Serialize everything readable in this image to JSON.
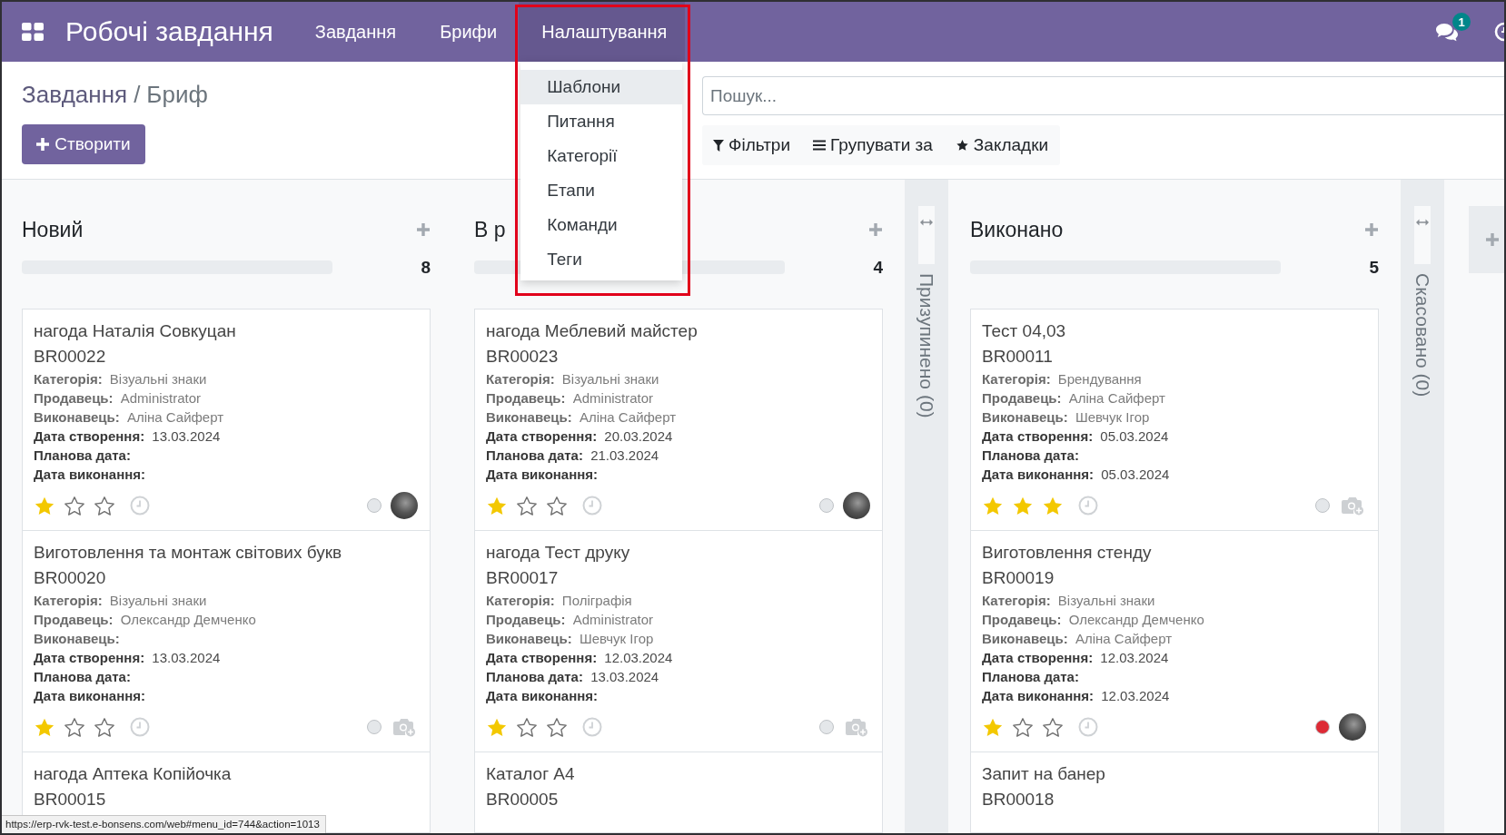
{
  "navbar": {
    "app_title": "Робочі завдання",
    "menu": [
      {
        "label": "Завдання",
        "expanded": false,
        "highlighted": false
      },
      {
        "label": "Брифи",
        "expanded": false,
        "highlighted": false
      },
      {
        "label": "Налаштування",
        "expanded": true,
        "highlighted": true,
        "submenu": [
          {
            "label": "Шаблони",
            "selected": true
          },
          {
            "label": "Питання",
            "selected": false
          },
          {
            "label": "Категорії",
            "selected": false
          },
          {
            "label": "Етапи",
            "selected": false
          },
          {
            "label": "Команди",
            "selected": false
          },
          {
            "label": "Теги",
            "selected": false
          }
        ]
      }
    ],
    "messages_badge": "1"
  },
  "breadcrumb": {
    "parent": "Завдання",
    "separator": "/",
    "current": "Бриф"
  },
  "create_button": "Створити",
  "search": {
    "placeholder": "Пошук..."
  },
  "search_options": [
    {
      "kind": "filter",
      "label": "Фільтри"
    },
    {
      "kind": "group",
      "label": "Групувати за"
    },
    {
      "kind": "favorite",
      "label": "Закладки"
    }
  ],
  "columns": [
    {
      "kind": "open",
      "title": "Новий",
      "count": "8",
      "level": 0,
      "cards": [
        {
          "title": "нагода Наталія Совкуцан",
          "code": "BR00022",
          "fields": [
            {
              "kind": "muted",
              "label": "Категорія:",
              "value": "Візуальні знаки"
            },
            {
              "kind": "muted",
              "label": "Продавець:",
              "value": "Administrator"
            },
            {
              "kind": "muted",
              "label": "Виконавець:",
              "value": "Аліна Сайферт"
            },
            {
              "kind": "plain",
              "label": "Дата створення:",
              "value": "13.03.2024"
            },
            {
              "kind": "plain",
              "label": "Планова дата:"
            },
            {
              "kind": "plain",
              "label": "Дата виконання:"
            }
          ],
          "stars": 1,
          "status_dot": {
            "color": "#e4e7ea"
          },
          "avatar": true
        },
        {
          "title": "Виготовлення та монтаж світових букв",
          "code": "BR00020",
          "fields": [
            {
              "kind": "muted",
              "label": "Категорія:",
              "value": "Візуальні знаки"
            },
            {
              "kind": "muted",
              "label": "Продавець:",
              "value": "Олександр Демченко"
            },
            {
              "kind": "muted",
              "label": "Виконавець:"
            },
            {
              "kind": "plain",
              "label": "Дата створення:",
              "value": "13.03.2024"
            },
            {
              "kind": "plain",
              "label": "Планова дата:"
            },
            {
              "kind": "plain",
              "label": "Дата виконання:"
            }
          ],
          "stars": 1,
          "status_dot": {
            "color": "#e4e7ea"
          },
          "avatar": false
        },
        {
          "title": "нагода Аптека Копійочка",
          "code": "BR00015"
        }
      ]
    },
    {
      "kind": "open",
      "title": "В р",
      "count": "4",
      "level": 0,
      "cards": [
        {
          "title": "нагода Меблевий майстер",
          "code": "BR00023",
          "fields": [
            {
              "kind": "muted",
              "label": "Категорія:",
              "value": "Візуальні знаки"
            },
            {
              "kind": "muted",
              "label": "Продавець:",
              "value": "Administrator"
            },
            {
              "kind": "muted",
              "label": "Виконавець:",
              "value": "Аліна Сайферт"
            },
            {
              "kind": "plain",
              "label": "Дата створення:",
              "value": "20.03.2024"
            },
            {
              "kind": "plain",
              "label": "Планова дата:",
              "value": "21.03.2024"
            },
            {
              "kind": "plain",
              "label": "Дата виконання:"
            }
          ],
          "stars": 1,
          "status_dot": {
            "color": "#e4e7ea"
          },
          "avatar": true
        },
        {
          "title": "нагода Тест друку",
          "code": "BR00017",
          "fields": [
            {
              "kind": "muted",
              "label": "Категорія:",
              "value": "Поліграфія"
            },
            {
              "kind": "muted",
              "label": "Продавець:",
              "value": "Administrator"
            },
            {
              "kind": "muted",
              "label": "Виконавець:",
              "value": "Шевчук Ігор"
            },
            {
              "kind": "plain",
              "label": "Дата створення:",
              "value": "12.03.2024"
            },
            {
              "kind": "plain",
              "label": "Планова дата:",
              "value": "13.03.2024"
            },
            {
              "kind": "plain",
              "label": "Дата виконання:"
            }
          ],
          "stars": 1,
          "status_dot": {
            "color": "#e4e7ea"
          },
          "avatar": false
        },
        {
          "title": "Каталог А4",
          "code": "BR00005"
        }
      ]
    },
    {
      "kind": "folded",
      "title": "Призупинено (0)"
    },
    {
      "kind": "open",
      "title": "Виконано",
      "count": "5",
      "level": 0,
      "cards": [
        {
          "title": "Тест 04,03",
          "code": "BR00011",
          "fields": [
            {
              "kind": "muted",
              "label": "Категорія:",
              "value": "Брендування"
            },
            {
              "kind": "muted",
              "label": "Продавець:",
              "value": "Аліна Сайферт"
            },
            {
              "kind": "muted",
              "label": "Виконавець:",
              "value": "Шевчук Ігор"
            },
            {
              "kind": "plain",
              "label": "Дата створення:",
              "value": "05.03.2024"
            },
            {
              "kind": "plain",
              "label": "Планова дата:"
            },
            {
              "kind": "plain",
              "label": "Дата виконання:",
              "value": "05.03.2024"
            }
          ],
          "stars": 3,
          "status_dot": {
            "color": "#e4e7ea"
          },
          "avatar": false
        },
        {
          "title": "Виготовлення стенду",
          "code": "BR00019",
          "fields": [
            {
              "kind": "muted",
              "label": "Категорія:",
              "value": "Візуальні знаки"
            },
            {
              "kind": "muted",
              "label": "Продавець:",
              "value": "Олександр Демченко"
            },
            {
              "kind": "muted",
              "label": "Виконавець:",
              "value": "Аліна Сайферт"
            },
            {
              "kind": "plain",
              "label": "Дата створення:",
              "value": "12.03.2024"
            },
            {
              "kind": "plain",
              "label": "Планова дата:"
            },
            {
              "kind": "plain",
              "label": "Дата виконання:",
              "value": "12.03.2024"
            }
          ],
          "stars": 1,
          "status_dot": {
            "color": "#dd2a35"
          },
          "avatar": true
        },
        {
          "title": "Запит на банер",
          "code": "BR00018"
        }
      ]
    },
    {
      "kind": "folded",
      "title": "Скасовано (0)"
    }
  ],
  "status_url": "https://erp-rvk-test.e-bonsens.com/web#menu_id=744&action=1013"
}
